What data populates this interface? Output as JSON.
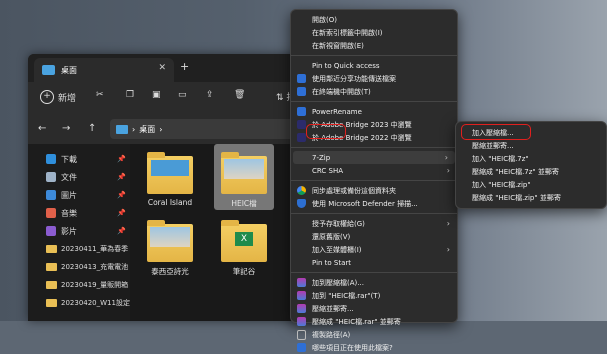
{
  "window": {
    "tab_title": "桌面",
    "new_button": "新增",
    "sort_button": "排序",
    "breadcrumb": "桌面"
  },
  "sidebar": {
    "quick_access": [
      {
        "label": "下載",
        "color": "#2f8fdc"
      },
      {
        "label": "文件",
        "color": "#9fb3c8"
      },
      {
        "label": "圖片",
        "color": "#3d8ad9"
      },
      {
        "label": "音樂",
        "color": "#e0604a"
      },
      {
        "label": "影片",
        "color": "#8b5cd0"
      }
    ],
    "folders": [
      "20230411_華為春季",
      "20230413_充電電池",
      "20230419_量販開箱",
      "20230420_W11設定"
    ]
  },
  "files": [
    {
      "name": "Coral Island"
    },
    {
      "name": "HEIC檔"
    },
    {
      "name": "泰西亞詩光"
    },
    {
      "name": "筆記谷"
    }
  ],
  "context_menu": {
    "items": [
      {
        "label": "開啟(O)",
        "icon": "blank"
      },
      {
        "label": "在新索引標籤中開啟(I)",
        "icon": "blank"
      },
      {
        "label": "在新視窗開啟(E)",
        "icon": "blank"
      },
      {
        "label": "Pin to Quick access",
        "icon": "blank"
      },
      {
        "label": "使用鄰近分享功能傳送檔案",
        "icon": "share"
      },
      {
        "label": "在終端機中開啟(T)",
        "icon": "terminal"
      },
      {
        "label": "PowerRename",
        "icon": "powerrename"
      },
      {
        "label": "於 Adobe Bridge 2023 中瀏覽",
        "icon": "adobe-bridge"
      },
      {
        "label": "於 Adobe Bridge 2022 中瀏覽",
        "icon": "adobe-bridge"
      },
      {
        "label": "7-Zip",
        "icon": "blank",
        "submenu": true
      },
      {
        "label": "CRC SHA",
        "icon": "blank",
        "submenu": true
      },
      {
        "label": "同步處理或備份這個資料夾",
        "icon": "google-drive"
      },
      {
        "label": "使用 Microsoft Defender 掃描...",
        "icon": "defender"
      },
      {
        "label": "授予存取權給(G)",
        "icon": "blank",
        "submenu": true
      },
      {
        "label": "還原舊版(V)",
        "icon": "blank"
      },
      {
        "label": "加入至媒體櫃(I)",
        "icon": "blank",
        "submenu": true
      },
      {
        "label": "Pin to Start",
        "icon": "blank"
      },
      {
        "label": "加到壓縮檔(A)...",
        "icon": "winrar"
      },
      {
        "label": "加到 \"HEIC檔.rar\"(T)",
        "icon": "winrar"
      },
      {
        "label": "壓縮並郵寄...",
        "icon": "winrar"
      },
      {
        "label": "壓縮成 \"HEIC檔.rar\" 並郵寄",
        "icon": "winrar"
      },
      {
        "label": "複製路徑(A)",
        "icon": "clipboard"
      },
      {
        "label": "哪些項目正在使用此檔案?",
        "icon": "powertoys"
      }
    ]
  },
  "zip_submenu": {
    "items": [
      "加入壓縮檔...",
      "壓縮並郵寄...",
      "加入 \"HEIC檔.7z\"",
      "壓縮成 \"HEIC檔.7z\" 並郵寄",
      "加入 \"HEIC檔.zip\"",
      "壓縮成 \"HEIC檔.zip\" 並郵寄"
    ]
  },
  "colors": {
    "highlight_box": "#e0201e",
    "menu_bg": "#2c2c2c",
    "folder": "#e9bf55"
  }
}
